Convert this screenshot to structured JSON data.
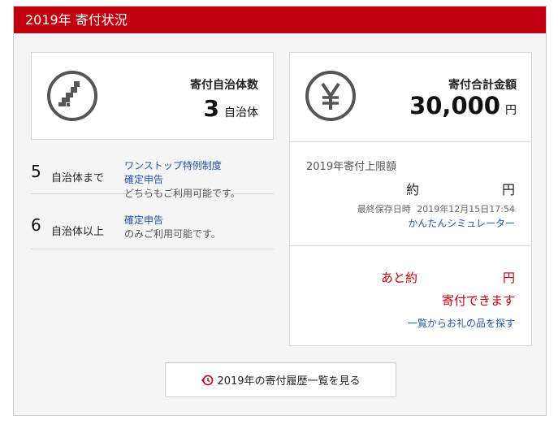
{
  "header": {
    "title": "2019年 寄付状況"
  },
  "municipalities_card": {
    "icon": "japan-map-icon",
    "label": "寄付自治体数",
    "value": "3",
    "unit": "自治体"
  },
  "amount_card": {
    "icon": "yen-icon",
    "label": "寄付合計金額",
    "value": "30,000",
    "unit": "円"
  },
  "rules": [
    {
      "count": "5",
      "condition": "自治体まで",
      "links": [
        "ワンストップ特例制度",
        "確定申告"
      ],
      "note": "どちらもご利用可能です。"
    },
    {
      "count": "6",
      "condition": "自治体以上",
      "links": [
        "確定申告"
      ],
      "note": "のみご利用可能です。"
    }
  ],
  "limit": {
    "title": "2019年寄付上限額",
    "prefix": "約",
    "unit": "円",
    "saved_label": "最終保存日時",
    "saved_at": "2019年12月15日17:54",
    "simulator_link": "かんたんシミュレーター"
  },
  "remaining": {
    "prefix": "あと約",
    "unit": "円",
    "message": "寄付できます",
    "search_link": "一覧からお礼の品を探す"
  },
  "history_button": {
    "label": "2019年の寄付履歴一覧を見る",
    "icon": "history-icon"
  },
  "colors": {
    "accent": "#c0000f",
    "link": "#2255aa",
    "remaining_text": "#c0000f"
  }
}
